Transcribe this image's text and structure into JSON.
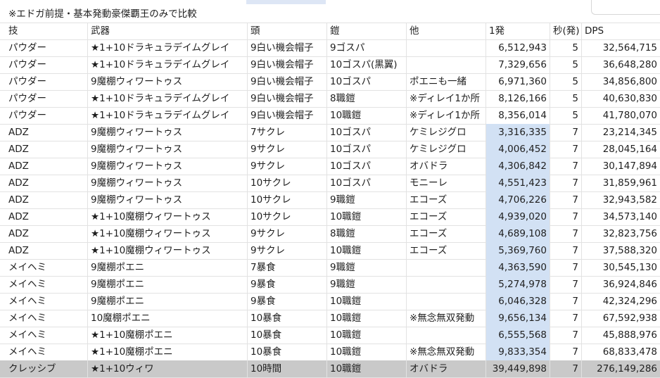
{
  "note": "※エドガ前提・基本発動豪傑覇王のみで比較",
  "headers": [
    "技",
    "武器",
    "頭",
    "鎧",
    "他",
    "1発",
    "秒(発)",
    "DPS"
  ],
  "rows": [
    [
      "パウダー",
      "★1+10ドラキュラデイムグレイ",
      "9白い機会帽子",
      "9ゴスパ",
      "",
      "6,512,943",
      "5",
      "32,564,715"
    ],
    [
      "パウダー",
      "★1+10ドラキュラデイムグレイ",
      "9白い機会帽子",
      "10ゴスパ(黒翼)",
      "",
      "7,329,656",
      "5",
      "36,648,280"
    ],
    [
      "パウダー",
      "9魔棚ウィワートゥス",
      "9白い機会帽子",
      "10ゴスパ",
      "ポエニも一緒",
      "6,971,360",
      "5",
      "34,856,800"
    ],
    [
      "パウダー",
      "★1+10ドラキュラデイムグレイ",
      "9白い機会帽子",
      "8職鎧",
      "※ディレイ1か所",
      "8,126,166",
      "5",
      "40,630,830"
    ],
    [
      "パウダー",
      "★1+10ドラキュラデイムグレイ",
      "9白い機会帽子",
      "10職鎧",
      "※ディレイ1か所",
      "8,356,014",
      "5",
      "41,780,070"
    ],
    [
      "ADZ",
      "9魔棚ウィワートゥス",
      "7サクレ",
      "10ゴスパ",
      "ケミレジグロ",
      "3,316,335",
      "7",
      "23,214,345"
    ],
    [
      "ADZ",
      "9魔棚ウィワートゥス",
      "9サクレ",
      "10ゴスパ",
      "ケミレジグロ",
      "4,006,452",
      "7",
      "28,045,164"
    ],
    [
      "ADZ",
      "9魔棚ウィワートゥス",
      "9サクレ",
      "10ゴスパ",
      "オバドラ",
      "4,306,842",
      "7",
      "30,147,894"
    ],
    [
      "ADZ",
      "9魔棚ウィワートゥス",
      "10サクレ",
      "10ゴスパ",
      "モニーレ",
      "4,551,423",
      "7",
      "31,859,961"
    ],
    [
      "ADZ",
      "9魔棚ウィワートゥス",
      "10サクレ",
      "9職鎧",
      "エコーズ",
      "4,706,226",
      "7",
      "32,943,582"
    ],
    [
      "ADZ",
      "★1+10魔棚ウィワートゥス",
      "10サクレ",
      "10職鎧",
      "エコーズ",
      "4,939,020",
      "7",
      "34,573,140"
    ],
    [
      "ADZ",
      "★1+10魔棚ウィワートゥス",
      "9サクレ",
      "8職鎧",
      "エコーズ",
      "4,689,108",
      "7",
      "32,823,756"
    ],
    [
      "ADZ",
      "★1+10魔棚ウィワートゥス",
      "9サクレ",
      "10職鎧",
      "エコーズ",
      "5,369,760",
      "7",
      "37,588,320"
    ],
    [
      "メイヘミ",
      "9魔棚ポエニ",
      "7暴食",
      "9職鎧",
      "",
      "4,363,590",
      "7",
      "30,545,130"
    ],
    [
      "メイヘミ",
      "9魔棚ポエニ",
      "9暴食",
      "9職鎧",
      "",
      "5,274,978",
      "7",
      "36,924,846"
    ],
    [
      "メイヘミ",
      "9魔棚ポエニ",
      "9暴食",
      "10職鎧",
      "",
      "6,046,328",
      "7",
      "42,324,296"
    ],
    [
      "メイヘミ",
      "10魔棚ポエニ",
      "10暴食",
      "10職鎧",
      "※無念無双発動",
      "9,656,134",
      "7",
      "67,592,938"
    ],
    [
      "メイヘミ",
      "★1+10魔棚ポエニ",
      "10暴食",
      "10職鎧",
      "",
      "6,555,568",
      "7",
      "45,888,976"
    ],
    [
      "メイヘミ",
      "★1+10魔棚ポエニ",
      "10暴食",
      "10職鎧",
      "※無念無双発動",
      "9,833,354",
      "7",
      "68,833,478"
    ],
    [
      "クレッシブ",
      "★1+10ウィワ",
      "10時間",
      "10職鎧",
      "オバドラ",
      "39,449,898",
      "7",
      "276,149,286"
    ]
  ],
  "highlight_rows_from": 5,
  "total_row_index": 19,
  "colors": {
    "highlight": "#d2e1f4",
    "total": "#c9c9c9",
    "grid": "#e2e2e2"
  }
}
